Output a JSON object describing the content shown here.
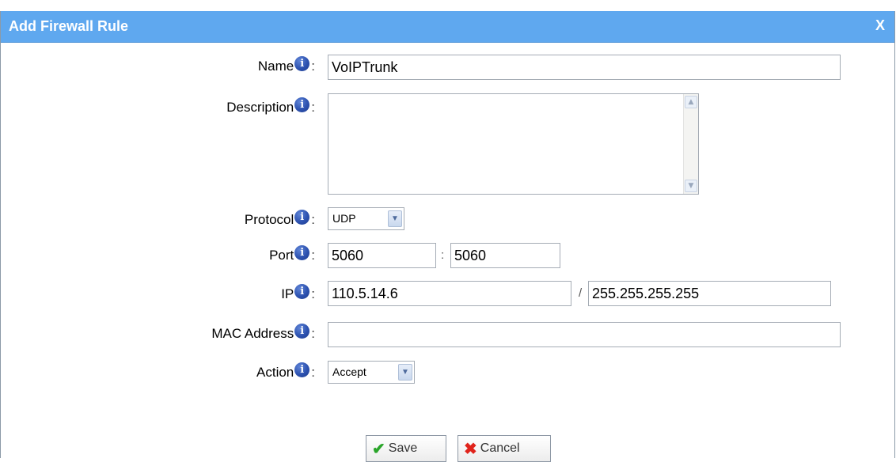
{
  "dialog": {
    "title": "Add Firewall Rule",
    "close_label": "X"
  },
  "form": {
    "name": {
      "label": "Name",
      "value": "VoIPTrunk"
    },
    "description": {
      "label": "Description",
      "value": ""
    },
    "protocol": {
      "label": "Protocol",
      "selected": "UDP"
    },
    "port": {
      "label": "Port",
      "from": "5060",
      "separator": ":",
      "to": "5060"
    },
    "ip": {
      "label": "IP",
      "address": "110.5.14.6",
      "separator": "/",
      "mask": "255.255.255.255"
    },
    "mac": {
      "label": "MAC Address",
      "value": ""
    },
    "action": {
      "label": "Action",
      "selected": "Accept"
    },
    "colon": ":",
    "info_glyph": "i"
  },
  "buttons": {
    "save": "Save",
    "cancel": "Cancel"
  },
  "icons": {
    "info": "info-icon",
    "save": "checkmark-icon",
    "cancel": "cross-icon",
    "dropdown": "chevron-down-icon"
  },
  "colors": {
    "titlebar": "#5fa8ef",
    "info_icon": "#2d52b0",
    "save_check": "#2aa52a",
    "cancel_cross": "#e0231b"
  }
}
